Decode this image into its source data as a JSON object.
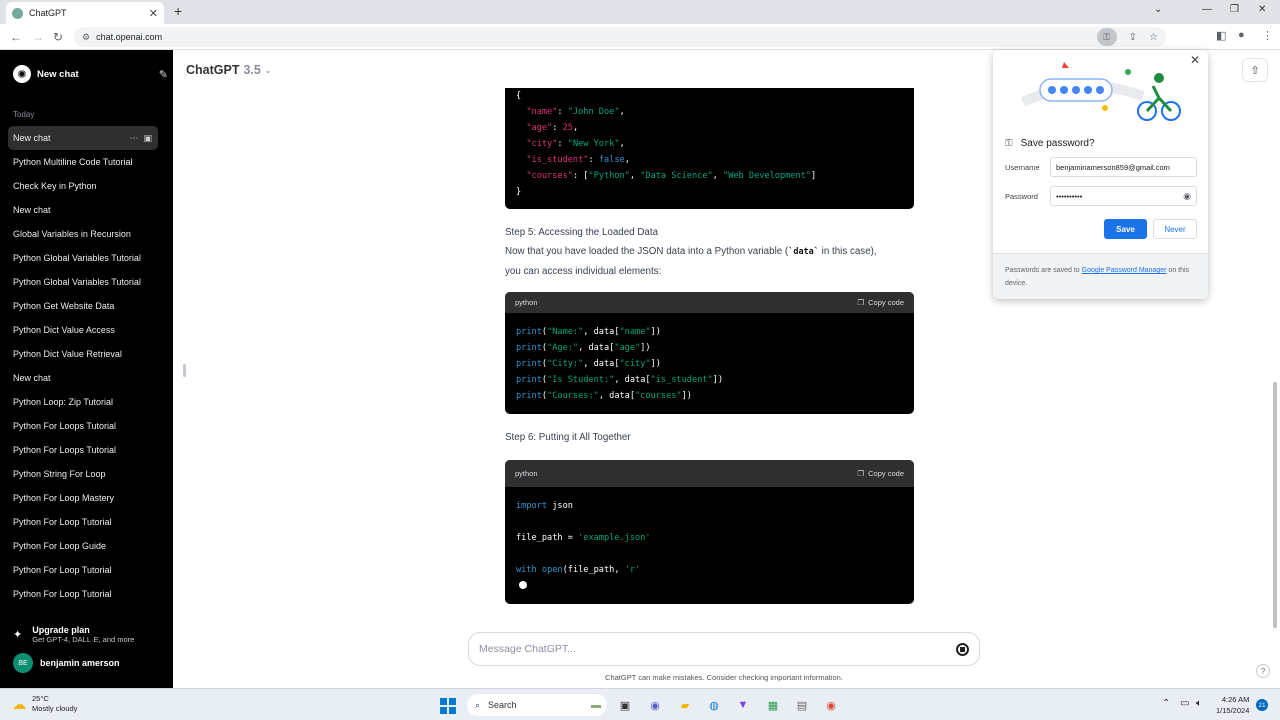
{
  "browser": {
    "tab_title": "ChatGPT",
    "url": "chat.openai.com",
    "new_tab_glyph": "+",
    "close_glyph": "✕",
    "back_glyph": "←",
    "forward_glyph": "→",
    "reload_glyph": "↻"
  },
  "sidebar": {
    "new_chat_label": "New chat",
    "section_today": "Today",
    "history": [
      "New chat",
      "Python Multiline Code Tutorial",
      "Check Key in Python",
      "New chat",
      "Global Variables in Recursion",
      "Python Global Variables Tutorial",
      "Python Global Variables Tutorial",
      "Python Get Website Data",
      "Python Dict Value Access",
      "Python Dict Value Retrieval",
      "New chat",
      "Python Loop: Zip Tutorial",
      "Python For Loops Tutorial",
      "Python For Loops Tutorial",
      "Python String For Loop",
      "Python For Loop Mastery",
      "Python For Loop Tutorial",
      "Python For Loop Guide",
      "Python For Loop Tutorial",
      "Python For Loop Tutorial"
    ],
    "upgrade_title": "Upgrade plan",
    "upgrade_sub": "Get GPT-4, DALL·E, and more",
    "user_initials": "BE",
    "user_name": "benjamin amerson"
  },
  "main": {
    "model_name": "ChatGPT",
    "model_version": "3.5",
    "step5_heading": "Step 5: Accessing the Loaded Data",
    "step5_text_a": "Now that you have loaded the JSON data into a Python variable (",
    "step5_code": "`data`",
    "step5_text_b": " in this case),",
    "step5_text_c": "you can access individual elements:",
    "step6_heading": "Step 6: Putting it All Together",
    "lang_label": "python",
    "copy_label": "Copy code",
    "message_placeholder": "Message ChatGPT...",
    "disclaimer": "ChatGPT can make mistakes. Consider checking important information.",
    "help_glyph": "?"
  },
  "password_popup": {
    "title": "Save password?",
    "username_label": "Username",
    "username_value": "benjaminamerson859@gmail.com",
    "password_label": "Password",
    "password_value": "••••••••••",
    "save_label": "Save",
    "never_label": "Never",
    "foot_a": "Passwords are saved to ",
    "foot_link": "Google Password Manager",
    "foot_b": " on this device."
  },
  "taskbar": {
    "temp": "25°C",
    "weather": "Mostly cloudy",
    "search_label": "Search",
    "time": "4:26 AM",
    "date": "1/15/2024",
    "notif_count": "21"
  },
  "colors": {
    "accent_blue": "#1a73e8",
    "code_bg": "#000000",
    "sidebar_bg": "#000000"
  }
}
